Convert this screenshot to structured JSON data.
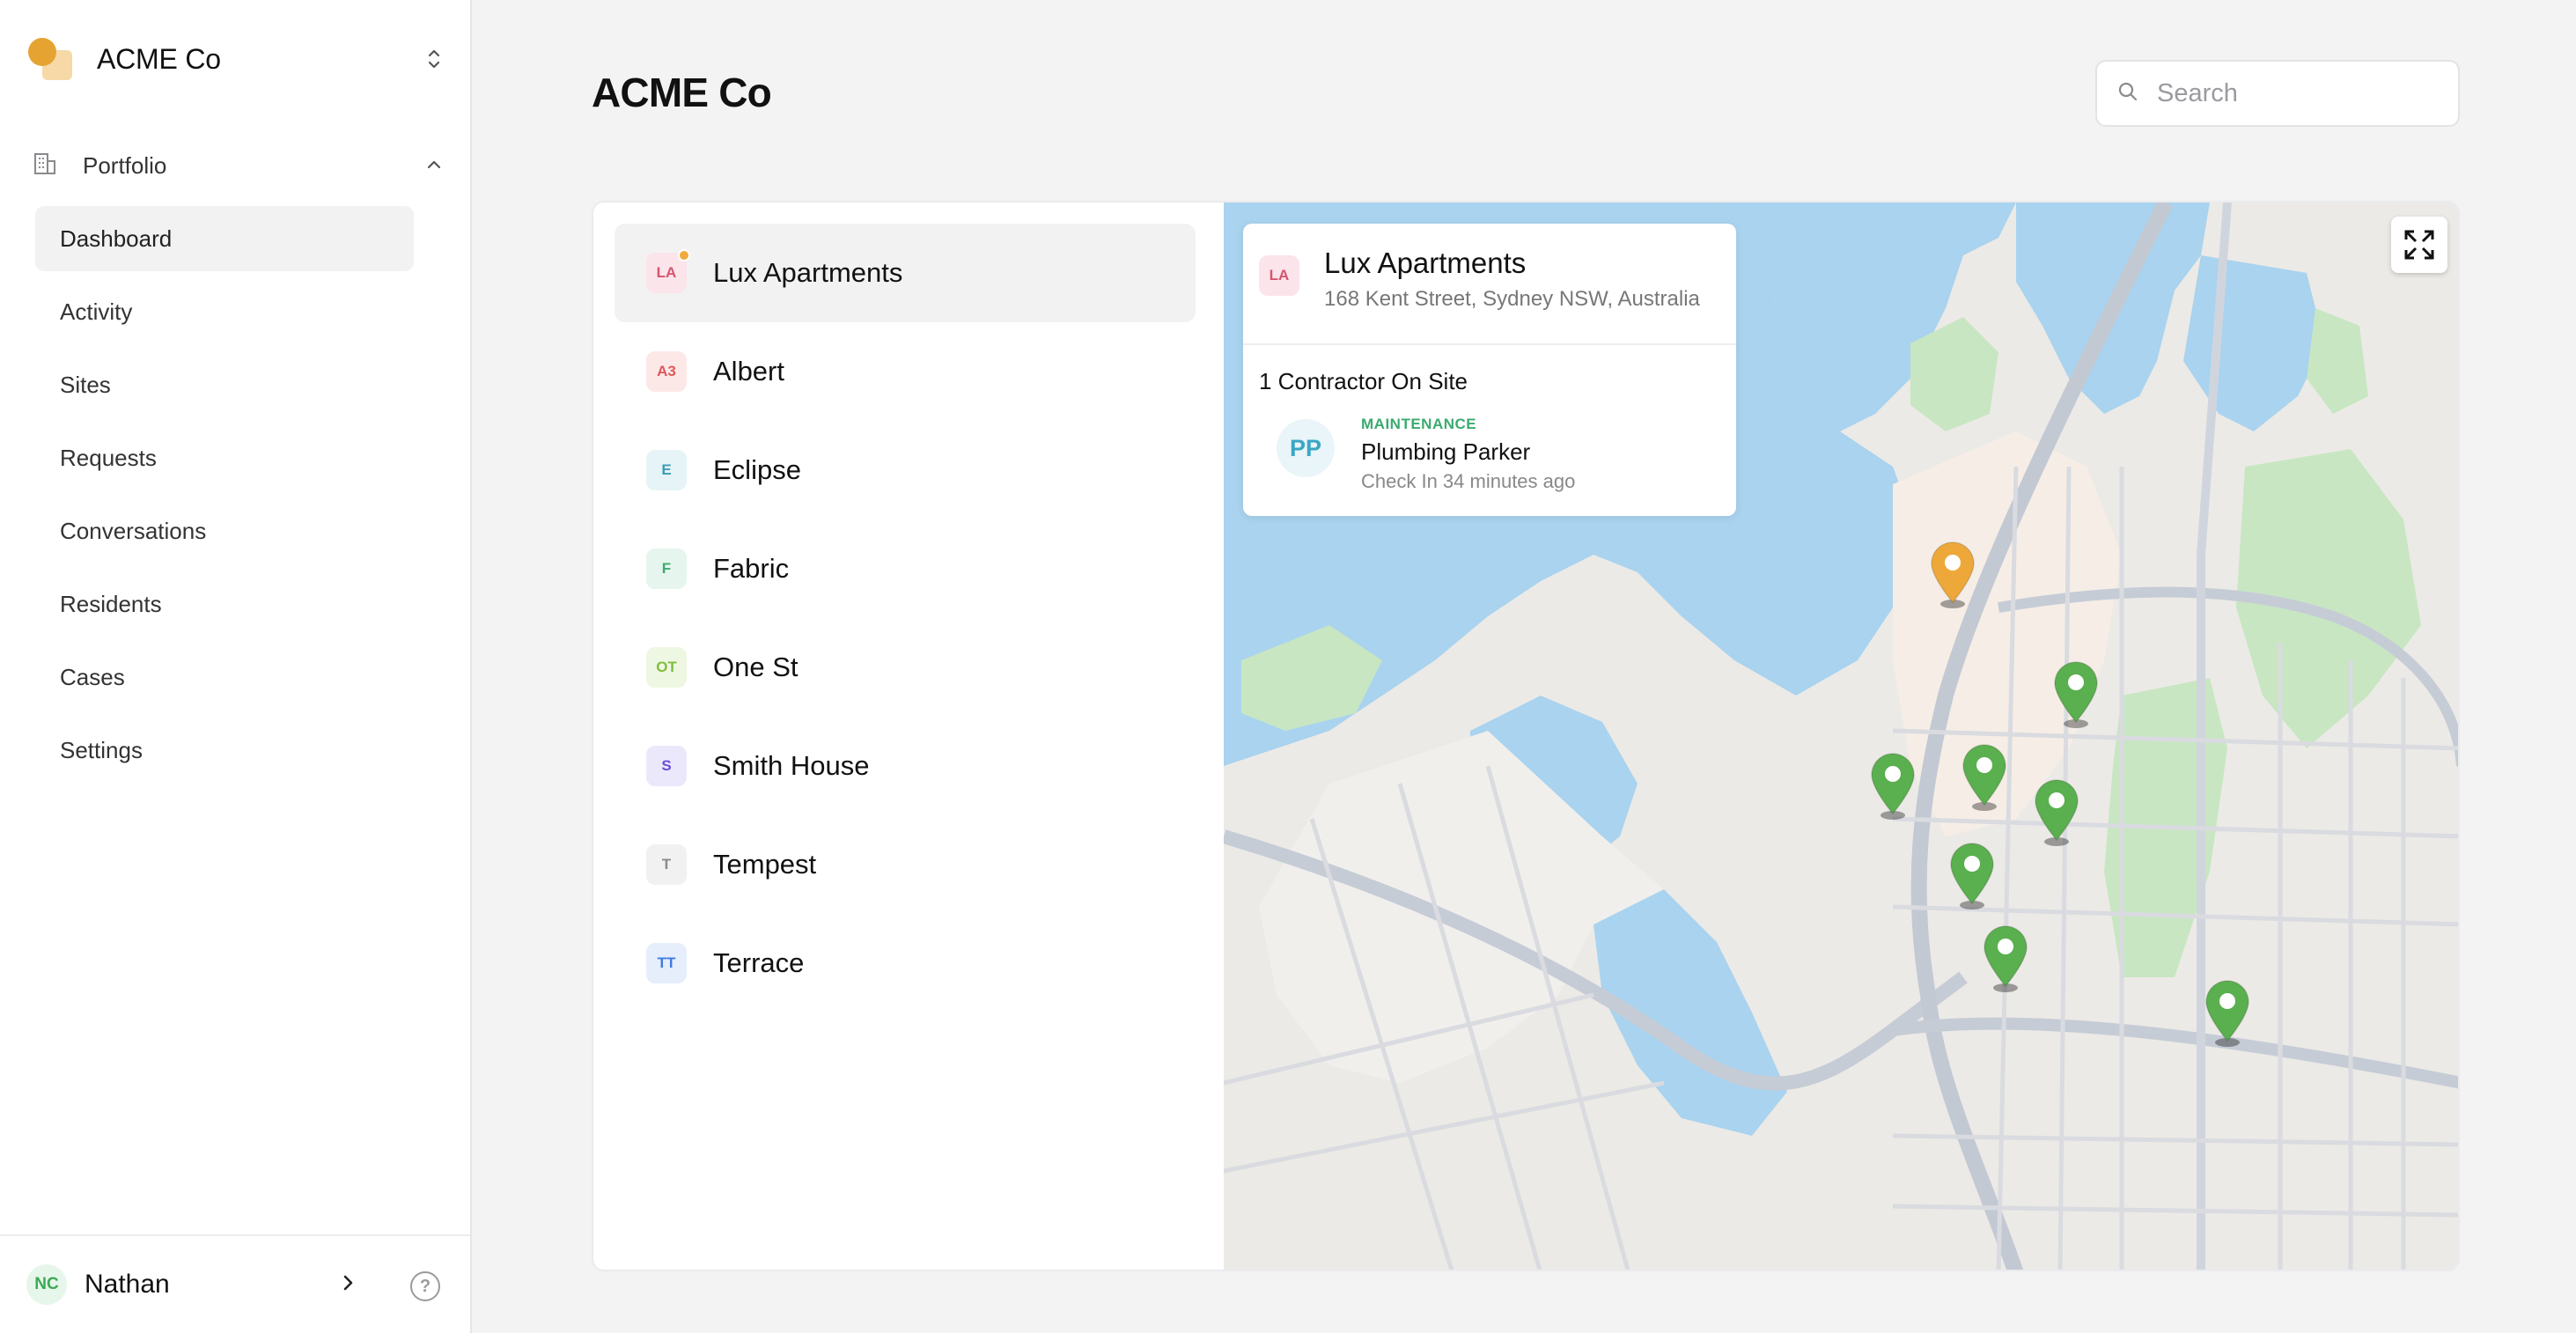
{
  "org": {
    "name": "ACME Co"
  },
  "nav": {
    "group_label": "Portfolio",
    "items": [
      {
        "label": "Dashboard",
        "active": true
      },
      {
        "label": "Activity"
      },
      {
        "label": "Sites"
      },
      {
        "label": "Requests"
      },
      {
        "label": "Conversations"
      },
      {
        "label": "Residents"
      },
      {
        "label": "Cases"
      },
      {
        "label": "Settings"
      }
    ]
  },
  "user": {
    "initials": "NC",
    "name": "Nathan"
  },
  "header": {
    "title": "ACME Co",
    "search_placeholder": "Search"
  },
  "sites": [
    {
      "initials": "LA",
      "name": "Lux Apartments",
      "active": true,
      "badge_bg": "#fbe4ea",
      "badge_fg": "#d6546f",
      "alert": true
    },
    {
      "initials": "A3",
      "name": "Albert",
      "badge_bg": "#fde8e8",
      "badge_fg": "#e0585a"
    },
    {
      "initials": "E",
      "name": "Eclipse",
      "badge_bg": "#e6f4f7",
      "badge_fg": "#3c9cb8"
    },
    {
      "initials": "F",
      "name": "Fabric",
      "badge_bg": "#e6f6ee",
      "badge_fg": "#3aab6f"
    },
    {
      "initials": "OT",
      "name": "One St",
      "badge_bg": "#eef7e2",
      "badge_fg": "#7fbf3a"
    },
    {
      "initials": "S",
      "name": "Smith House",
      "badge_bg": "#ece8fb",
      "badge_fg": "#6a4ed8"
    },
    {
      "initials": "T",
      "name": "Tempest",
      "badge_bg": "#f1f1f2",
      "badge_fg": "#8a8a8e"
    },
    {
      "initials": "TT",
      "name": "Terrace",
      "badge_bg": "#e6eefb",
      "badge_fg": "#3d7ce0"
    }
  ],
  "info": {
    "initials": "LA",
    "title": "Lux Apartments",
    "address": "168 Kent Street, Sydney NSW, Australia",
    "contractor_count": "1 Contractor On Site",
    "contractor": {
      "initials": "PP",
      "tag": "MAINTENANCE",
      "name": "Plumbing Parker",
      "meta": "Check In 34 minutes ago"
    }
  },
  "map": {
    "pins": [
      {
        "status": "selected",
        "color": "#eea83a"
      },
      {
        "status": "active",
        "color": "#5aaf4f"
      },
      {
        "status": "active",
        "color": "#5aaf4f"
      },
      {
        "status": "active",
        "color": "#5aaf4f"
      },
      {
        "status": "active",
        "color": "#5aaf4f"
      },
      {
        "status": "active",
        "color": "#5aaf4f"
      },
      {
        "status": "active",
        "color": "#5aaf4f"
      },
      {
        "status": "active",
        "color": "#5aaf4f"
      }
    ]
  }
}
